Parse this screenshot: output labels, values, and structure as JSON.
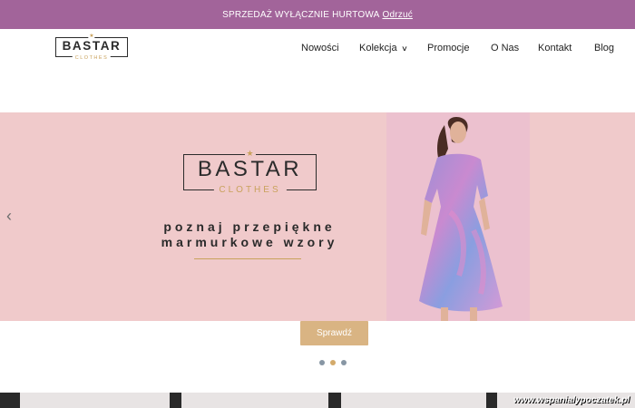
{
  "notice_bar": {
    "text": "SPRZEDAŻ WYŁĄCZNIE HURTOWA",
    "dismiss_label": "Odrzuć"
  },
  "header": {
    "logo_word": "BASTAR",
    "logo_sub": "CLOTHES",
    "nav": [
      {
        "label": "Nowości"
      },
      {
        "label": "Kolekcja",
        "has_dropdown": true
      },
      {
        "label": "Promocje"
      },
      {
        "label": "O Nas"
      },
      {
        "label": "Kontakt"
      },
      {
        "label": "Blog"
      }
    ]
  },
  "hero": {
    "logo_word": "BASTAR",
    "logo_sub": "CLOTHES",
    "tagline_line1": "poznaj przepiękne",
    "tagline_line2": "marmurkowe wzory",
    "cta_label": "Sprawdź",
    "slides_total": 3,
    "active_slide": 2
  },
  "watermark": "www.wspanialypoczatek.pl",
  "colors": {
    "notice_bg": "#a2649a",
    "hero_bg": "#f0cacb",
    "accent_gold": "#d9b483",
    "dot_inactive": "#8796a4",
    "dot_active": "#d3aa6b"
  }
}
